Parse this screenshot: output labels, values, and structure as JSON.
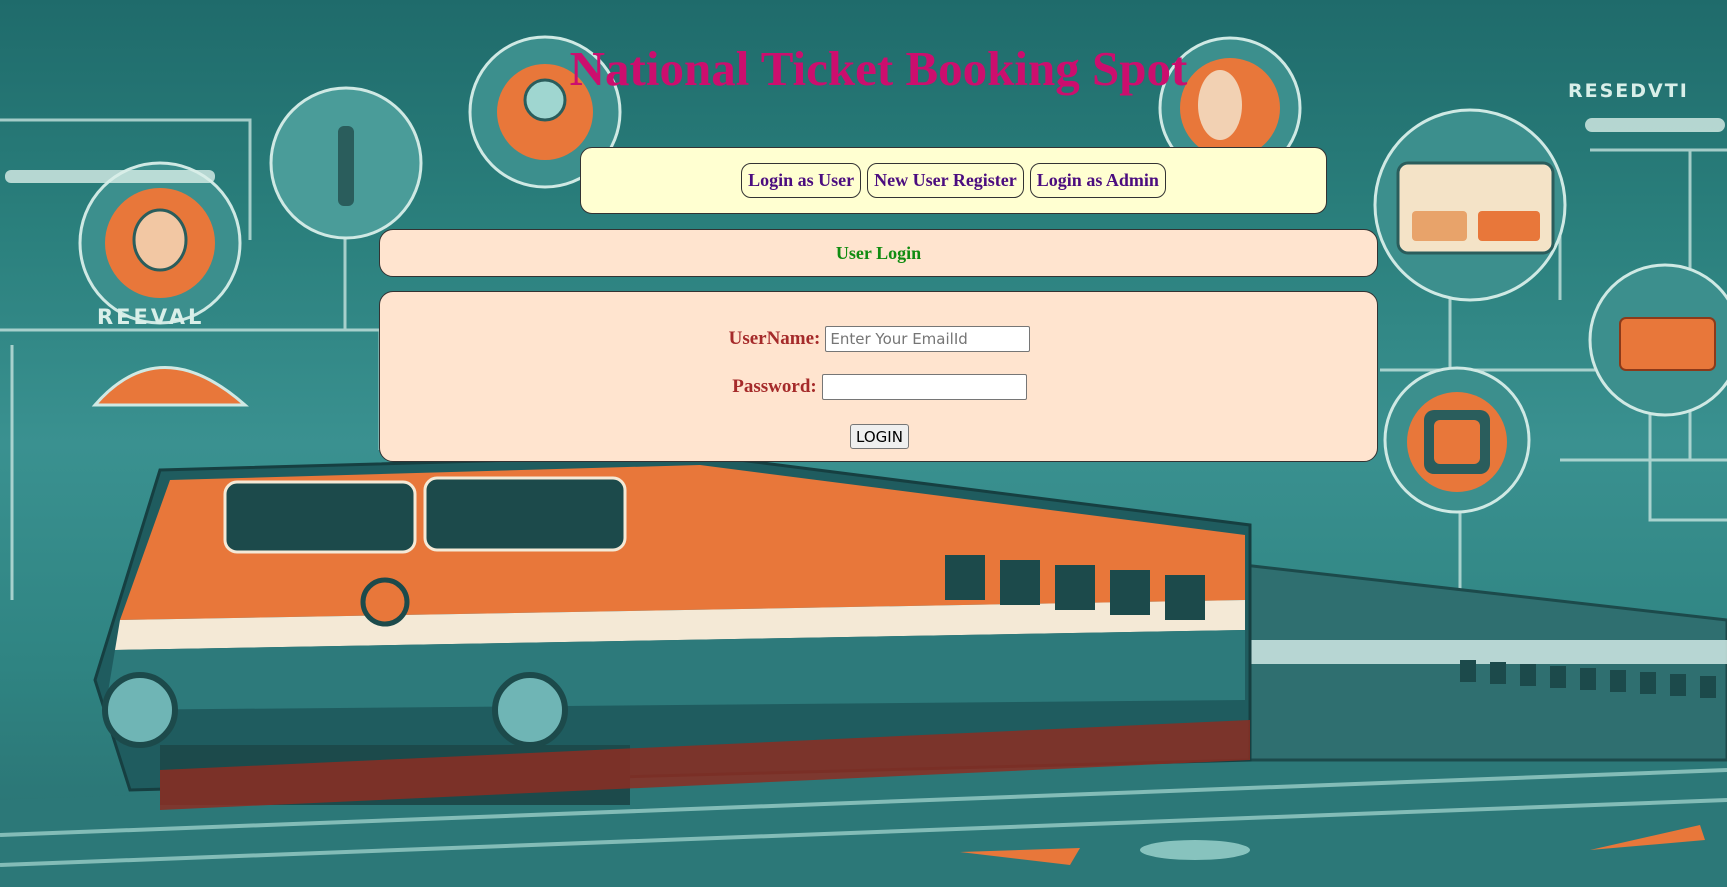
{
  "site": {
    "title": "National Ticket Booking Spot"
  },
  "nav": {
    "items": [
      {
        "label": "Login as User"
      },
      {
        "label": "New User Register"
      },
      {
        "label": "Login as Admin"
      }
    ]
  },
  "section": {
    "heading": "User Login"
  },
  "form": {
    "username_label": "UserName:",
    "username_value": "",
    "username_placeholder": "Enter Your EmailId",
    "password_label": "Password:",
    "password_value": "",
    "submit_label": "LOGIN"
  },
  "colors": {
    "title": "#cc0e6e",
    "nav_background": "#ffffd1",
    "nav_text": "#4b0d7f",
    "panel_background": "#ffe4cf",
    "heading_text": "#118c11",
    "label_text": "#a52a2a",
    "background_teal": "#2a7f7c"
  },
  "background": {
    "depicts": "train-illustration",
    "signs": [
      "RESEDVTI",
      "REEVAL"
    ]
  }
}
